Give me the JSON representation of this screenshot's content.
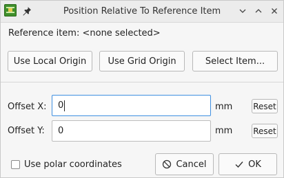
{
  "window": {
    "title": "Position Relative To Reference Item",
    "app_icon": "pcb-icon",
    "pin_icon": "pin-icon",
    "controls": [
      "chevron-down-icon",
      "chevron-up-icon",
      "close-icon"
    ]
  },
  "reference": {
    "label": "Reference item: <none selected>"
  },
  "buttons": {
    "use_local_origin": "Use Local Origin",
    "use_grid_origin": "Use Grid Origin",
    "select_item": "Select Item..."
  },
  "offset_x": {
    "label": "Offset X:",
    "value": "0",
    "unit": "mm",
    "reset": "Reset"
  },
  "offset_y": {
    "label": "Offset Y:",
    "value": "0",
    "unit": "mm",
    "reset": "Reset"
  },
  "polar": {
    "label": "Use polar coordinates",
    "checked": false
  },
  "footer": {
    "cancel": "Cancel",
    "ok": "OK"
  },
  "colors": {
    "focus_border": "#3d8ee0",
    "app_icon_green": "#3f8f2b"
  }
}
